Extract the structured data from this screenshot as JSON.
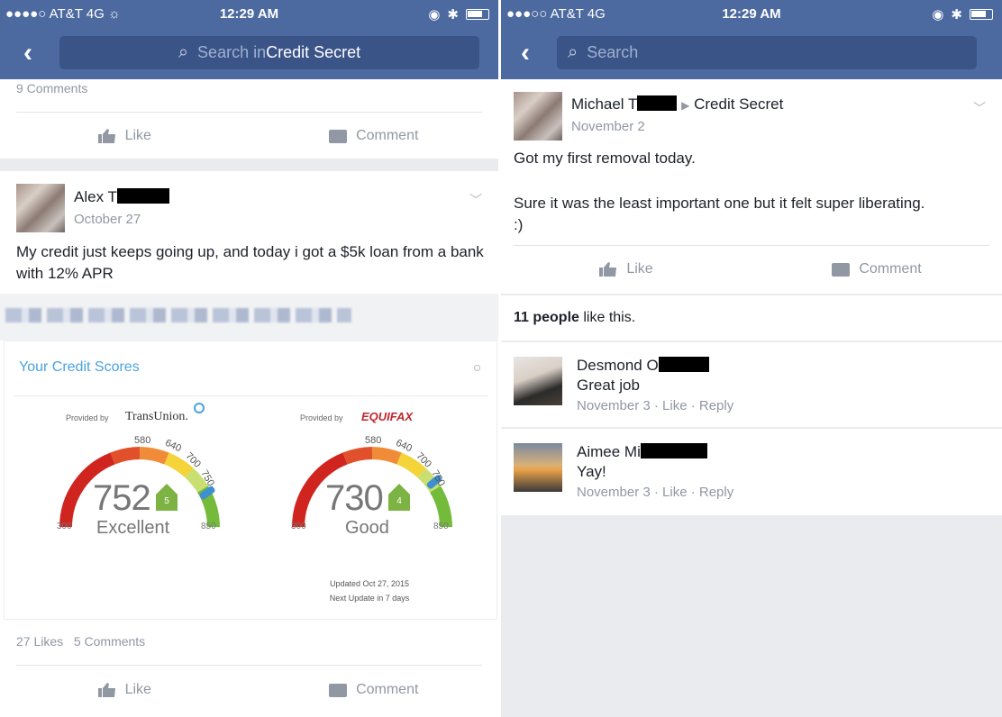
{
  "left": {
    "status": {
      "carrier": "●●●●○ AT&T  4G  ☼",
      "time": "12:29 AM"
    },
    "search": {
      "prefix": "Search in ",
      "group": "Credit Secret"
    },
    "prev_post": {
      "comments": "9 Comments",
      "like": "Like",
      "comment": "Comment"
    },
    "post": {
      "author": "Alex T",
      "date": "October 27",
      "text": "My credit just keeps going up, and today i got a $5k loan from a bank with 12% APR",
      "widget": {
        "title": "Your Credit Scores",
        "left_gauge": {
          "provided_by": "Provided by",
          "bureau": "TransUnion.",
          "score": "752",
          "rating": "Excellent",
          "badge": "5",
          "min": "300",
          "max": "850",
          "ticks": [
            "580",
            "640",
            "700",
            "750"
          ]
        },
        "right_gauge": {
          "provided_by": "Provided by",
          "bureau": "EQUIFAX",
          "score": "730",
          "rating": "Good",
          "badge": "4",
          "min": "300",
          "max": "850",
          "ticks": [
            "580",
            "640",
            "700",
            "750"
          ]
        },
        "updated": "Updated Oct 27, 2015",
        "next_update": "Next Update in 7 days"
      },
      "likes": "27 Likes",
      "comments": "5 Comments",
      "like": "Like",
      "comment": "Comment"
    }
  },
  "right": {
    "status": {
      "carrier": "●●●○○ AT&T  4G",
      "time": "12:29 AM"
    },
    "search": {
      "placeholder": "Search"
    },
    "post": {
      "author": "Michael T",
      "arrow": "▶",
      "group": "Credit Secret",
      "date": "November 2",
      "line1": "Got my first removal today.",
      "line2": "Sure it was the least important one but it felt super liberating. :)",
      "like": "Like",
      "comment": "Comment"
    },
    "likes_summary": {
      "count": "11 people",
      "suffix": " like this."
    },
    "comments": [
      {
        "name": "Desmond O",
        "text": "Great job",
        "meta": "November 3 · Like · Reply"
      },
      {
        "name": "Aimee Mi",
        "text": "Yay!",
        "meta": "November 3 · Like · Reply"
      }
    ]
  },
  "colors": {
    "nav": "#4c6a9f",
    "search": "#3b5488",
    "muted": "#9197a3",
    "link": "#4aa3df"
  }
}
